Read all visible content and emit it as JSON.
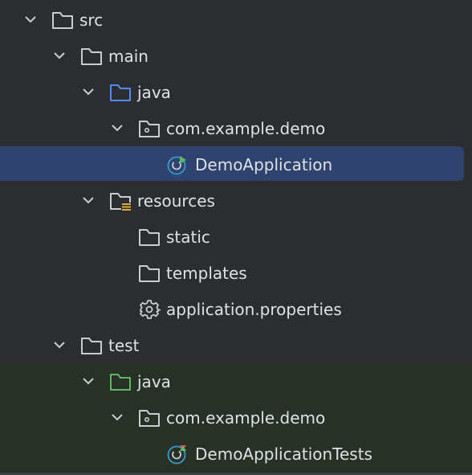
{
  "project_tree": {
    "items": [
      {
        "label": "src"
      },
      {
        "label": "main"
      },
      {
        "label": "java"
      },
      {
        "label": "com.example.demo"
      },
      {
        "label": "DemoApplication"
      },
      {
        "label": "resources"
      },
      {
        "label": "static"
      },
      {
        "label": "templates"
      },
      {
        "label": "application.properties"
      },
      {
        "label": "test"
      },
      {
        "label": "java"
      },
      {
        "label": "com.example.demo"
      },
      {
        "label": "DemoApplicationTests"
      }
    ]
  },
  "colors": {
    "background": "#2b2d30",
    "selection": "#2e436e",
    "test_background": "#273126",
    "text": "#dfe1e5",
    "source_root_folder": "#548af7",
    "test_root_folder": "#5fb865",
    "spring_icon": "#3592c4",
    "run_marker": "#5fb865"
  }
}
